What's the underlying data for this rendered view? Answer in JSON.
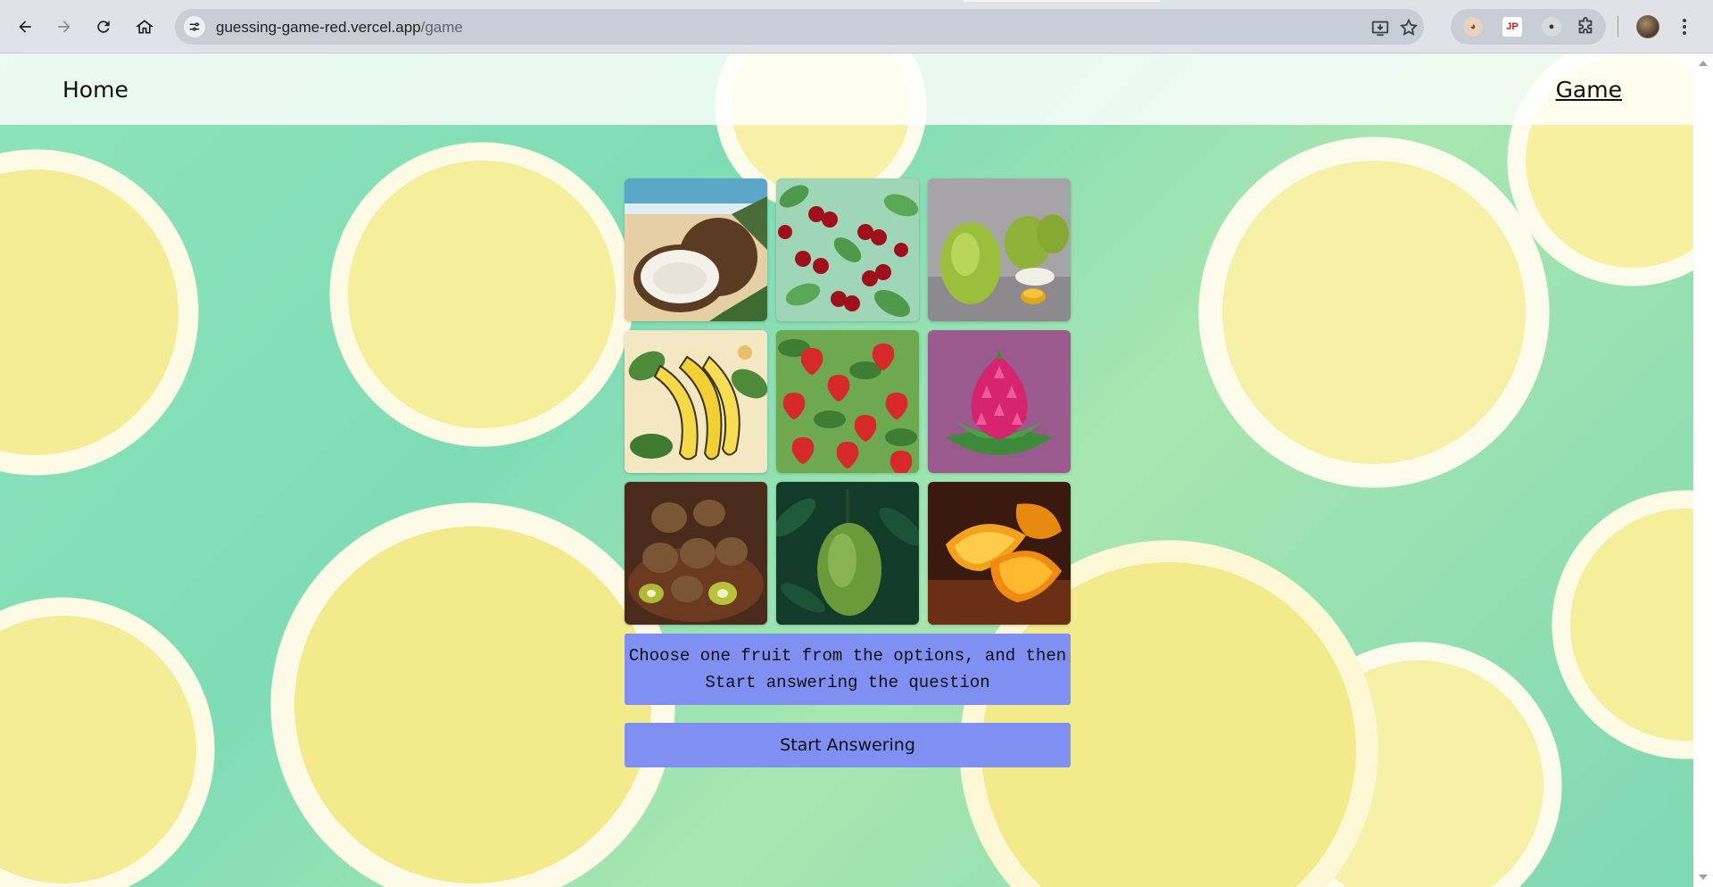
{
  "browser": {
    "url_host": "guessing-game-red.vercel.app",
    "url_path": "/game",
    "extensions": [
      "cat-face-extension-icon",
      "jp-extension-icon",
      "panda-extension-icon",
      "puzzle-extensions-icon"
    ]
  },
  "nav": {
    "home_label": "Home",
    "game_label": "Game"
  },
  "fruits": [
    {
      "name": "coconut",
      "image": "coconut-image"
    },
    {
      "name": "cherry",
      "image": "cherry-image"
    },
    {
      "name": "guava",
      "image": "guava-image"
    },
    {
      "name": "banana",
      "image": "banana-image"
    },
    {
      "name": "strawberry",
      "image": "strawberry-image"
    },
    {
      "name": "dragon-fruit",
      "image": "dragon-fruit-image"
    },
    {
      "name": "kiwi",
      "image": "kiwi-image"
    },
    {
      "name": "mango",
      "image": "mango-image"
    },
    {
      "name": "orange",
      "image": "orange-image"
    }
  ],
  "game": {
    "instruction_line1": "Choose one fruit from the options, and then",
    "instruction_line2": "Start answering the question",
    "start_button": "Start Answering"
  },
  "colors": {
    "accent": "#8090f2",
    "background_mint": "#7fdcb6",
    "lemon": "#f4ed96"
  }
}
